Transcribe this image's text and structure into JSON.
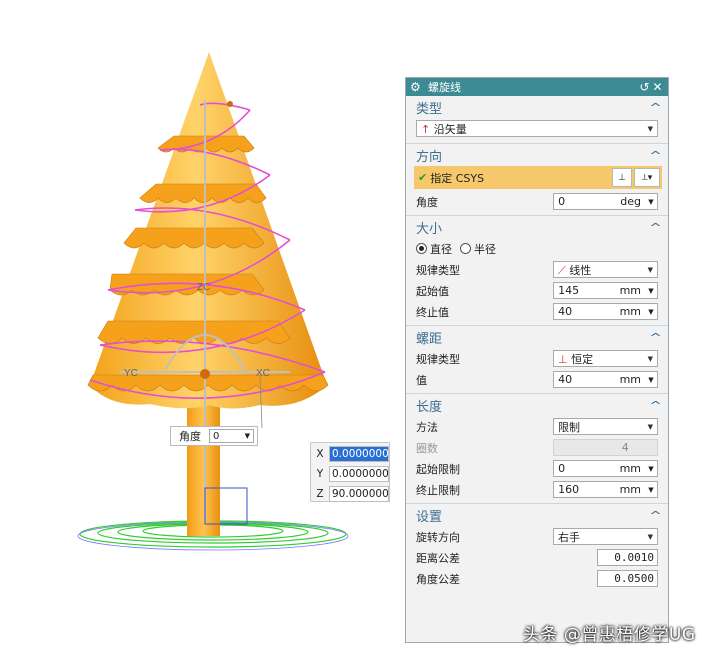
{
  "viewport": {
    "axis_labels": {
      "zc": "ZC",
      "yc": "YC",
      "xc": "XC"
    },
    "angle_widget": {
      "label": "角度",
      "value": "0"
    },
    "xyz_widget": {
      "x_label": "X",
      "x_value": "0.0000000",
      "y_label": "Y",
      "y_value": "0.0000000",
      "z_label": "Z",
      "z_value": "90.000000"
    }
  },
  "dialog": {
    "title": "螺旋线",
    "icons": {
      "gear": "gear-icon",
      "reset": "reset-icon",
      "close": "close-icon"
    },
    "sections": {
      "type": {
        "header": "类型",
        "dropdown": "沿矢量"
      },
      "direction": {
        "header": "方向",
        "csys_label": "指定 CSYS",
        "angle_label": "角度",
        "angle_value": "0",
        "angle_unit": "deg"
      },
      "size": {
        "header": "大小",
        "radio_diameter": "直径",
        "radio_radius": "半径",
        "law_label": "规律类型",
        "law_value": "线性",
        "start_label": "起始值",
        "start_value": "145",
        "start_unit": "mm",
        "end_label": "终止值",
        "end_value": "40",
        "end_unit": "mm"
      },
      "pitch": {
        "header": "螺距",
        "law_label": "规律类型",
        "law_value": "恒定",
        "value_label": "值",
        "value": "40",
        "value_unit": "mm"
      },
      "length": {
        "header": "长度",
        "method_label": "方法",
        "method_value": "限制",
        "turns_label": "圈数",
        "turns_value": "4",
        "start_limit_label": "起始限制",
        "start_limit_value": "0",
        "start_limit_unit": "mm",
        "end_limit_label": "终止限制",
        "end_limit_value": "160",
        "end_limit_unit": "mm"
      },
      "settings": {
        "header": "设置",
        "rotation_label": "旋转方向",
        "rotation_value": "右手",
        "distance_tol_label": "距离公差",
        "distance_tol_value": "0.0010",
        "angle_tol_label": "角度公差",
        "angle_tol_value": "0.0500"
      }
    }
  },
  "watermark": "头条 @曾惠梧修学UG",
  "colors": {
    "tree_orange": "#f8a51c",
    "helix_magenta": "#e24fd6",
    "title_bar": "#3c8a93",
    "csys_highlight": "#f7c86b",
    "base_green": "#33cc33"
  }
}
